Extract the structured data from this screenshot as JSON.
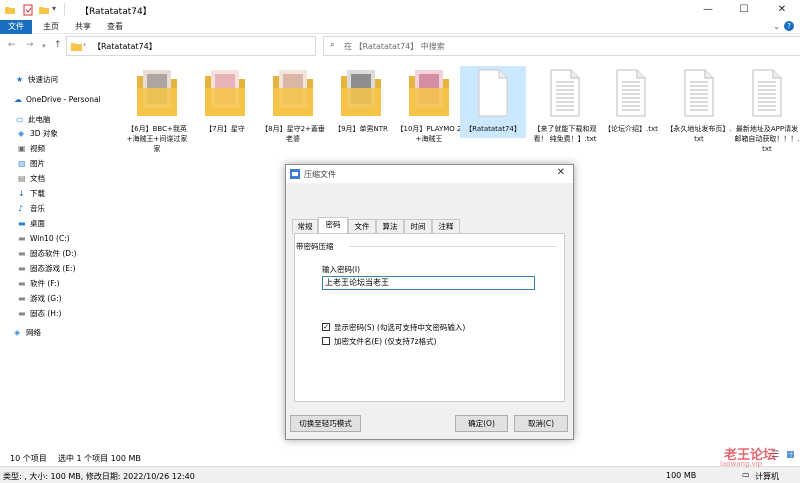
{
  "window": {
    "title": "【Ratatatat74】"
  },
  "ribbon": {
    "tabs": [
      "文件",
      "主页",
      "共享",
      "查看"
    ]
  },
  "address": {
    "path": "【Ratatatat74】",
    "search_placeholder": "在 【Ratatatat74】 中搜索"
  },
  "sidebar": {
    "items": [
      {
        "label": "快速访问",
        "icon": "star-icon"
      },
      {
        "label": "OneDrive - Personal",
        "icon": "cloud-icon"
      },
      {
        "label": "此电脑",
        "icon": "computer-icon"
      },
      {
        "label": "3D 对象",
        "icon": "cube-icon"
      },
      {
        "label": "视频",
        "icon": "video-icon"
      },
      {
        "label": "图片",
        "icon": "picture-icon"
      },
      {
        "label": "文档",
        "icon": "document-icon"
      },
      {
        "label": "下载",
        "icon": "download-icon"
      },
      {
        "label": "音乐",
        "icon": "music-icon"
      },
      {
        "label": "桌面",
        "icon": "desktop-icon"
      },
      {
        "label": "Win10 (C:)",
        "icon": "drive-icon"
      },
      {
        "label": "固态软件 (D:)",
        "icon": "drive-icon"
      },
      {
        "label": "固态游戏 (E:)",
        "icon": "drive-icon"
      },
      {
        "label": "软件 (F:)",
        "icon": "drive-icon"
      },
      {
        "label": "游戏 (G:)",
        "icon": "drive-icon"
      },
      {
        "label": "固态 (H:)",
        "icon": "drive-icon"
      },
      {
        "label": "网络",
        "icon": "network-icon"
      }
    ]
  },
  "files": [
    {
      "name": "【6月】BBC+我英+海贼王+间谍过家家",
      "type": "folder"
    },
    {
      "name": "【7月】星守",
      "type": "folder"
    },
    {
      "name": "【8月】星守2+蓋垂老婆",
      "type": "folder"
    },
    {
      "name": "【9月】单男NTR",
      "type": "folder"
    },
    {
      "name": "【10月】PLAYMO 2 +海贼王",
      "type": "folder"
    },
    {
      "name": "【Ratatatat74】",
      "type": "archive"
    },
    {
      "name": "【来了就能下载和观看！ 纯免费！】.txt",
      "type": "txt"
    },
    {
      "name": "【论坛介绍】.txt",
      "type": "txt"
    },
    {
      "name": "【永久地址发布页】.txt",
      "type": "txt"
    },
    {
      "name": "最新地址及APP请发邮箱自动获取！！！.txt",
      "type": "txt"
    }
  ],
  "status": {
    "count": "10 个项目",
    "selected": "选中 1 个项目  100 MB",
    "details": "类型: , 大小: 100 MB, 修改日期: 2022/10/26 12:40",
    "size": "100 MB",
    "computer": "计算机"
  },
  "dialog": {
    "title": "压缩文件",
    "tabs": [
      "常规",
      "密码",
      "文件",
      "算法",
      "时间",
      "注释"
    ],
    "group_title": "带密码压缩",
    "password_label": "输入密码(I)",
    "password_value": "上老王论坛当老王",
    "show_password": "显示密码(S)  (勾选可支持中文密码输入)",
    "encrypt_names": "加密文件名(E)  (仅支持7z格式)",
    "switch_button": "切换至轻巧模式",
    "ok_button": "确定(O)",
    "cancel_button": "取消(C)"
  },
  "watermark": {
    "text": "老王论坛",
    "url": "laowang.vip"
  },
  "colors": {
    "accent": "#1a6ec0",
    "selection": "#cce8ff",
    "watermark": "#d9363e"
  }
}
